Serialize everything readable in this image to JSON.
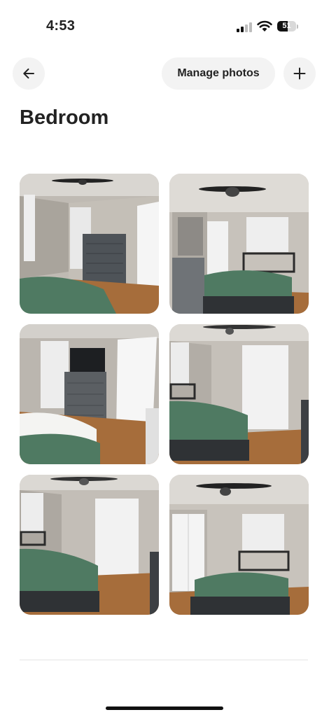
{
  "status_bar": {
    "time": "4:53",
    "battery_level": "51",
    "battery_fill_fraction": 0.56
  },
  "header": {
    "back_icon": "arrow-left-icon",
    "manage_photos_label": "Manage photos",
    "add_icon": "plus-icon"
  },
  "page": {
    "title": "Bedroom"
  },
  "photos": [
    {
      "id": "photo-1",
      "subject": "bedroom-dresser-ceiling-fan"
    },
    {
      "id": "photo-2",
      "subject": "bed-closet-window"
    },
    {
      "id": "photo-3",
      "subject": "dresser-tv-doorway"
    },
    {
      "id": "photo-4",
      "subject": "bed-window-ceiling-fan"
    },
    {
      "id": "photo-5",
      "subject": "bed-window-corner"
    },
    {
      "id": "photo-6",
      "subject": "bed-closet-doors"
    }
  ],
  "colors": {
    "bedspread": "#4f7a62",
    "wall": "#c9c4bd",
    "floor": "#a66d3b",
    "button_bg": "#f3f3f3"
  }
}
